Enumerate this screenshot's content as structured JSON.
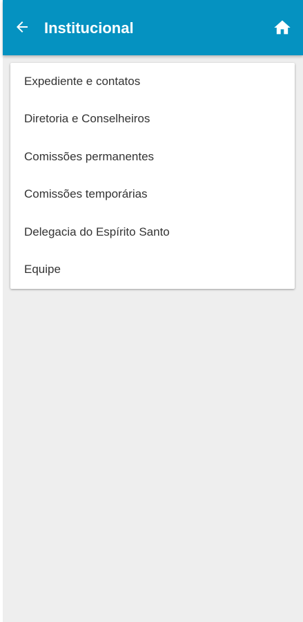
{
  "header": {
    "title": "Institucional",
    "back_icon": "arrow-left-icon",
    "home_icon": "home-icon",
    "background_color": "#0592c1",
    "text_color": "#ffffff"
  },
  "menu": {
    "items": [
      {
        "label": "Expediente e contatos"
      },
      {
        "label": "Diretoria e Conselheiros"
      },
      {
        "label": "Comissões permanentes"
      },
      {
        "label": "Comissões temporárias"
      },
      {
        "label": "Delegacia do Espírito Santo"
      },
      {
        "label": "Equipe"
      }
    ]
  },
  "page": {
    "background_color": "#eeeeee"
  }
}
